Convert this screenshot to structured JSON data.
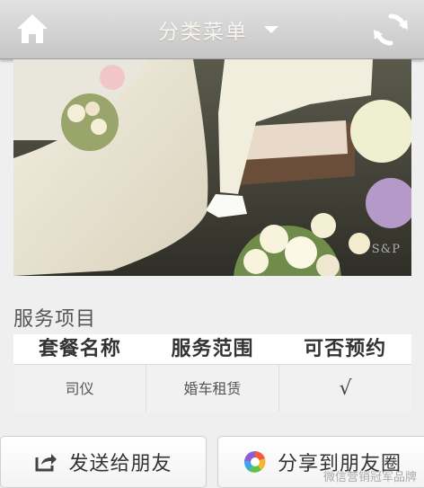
{
  "header": {
    "menu_title": "分类菜单",
    "home_icon": "home-icon",
    "refresh_icon": "refresh-icon"
  },
  "photo": {
    "watermark": "S&P"
  },
  "services": {
    "section_title": "服务项目",
    "columns": [
      "套餐名称",
      "服务范围",
      "可否预约"
    ],
    "rows": [
      {
        "name": "司仪",
        "scope": "婚车租赁",
        "bookable": "√"
      }
    ]
  },
  "actions": {
    "send_label": "发送给朋友",
    "share_label": "分享到朋友圈"
  },
  "footer": {
    "watermark_text": "微信营销冠军品牌"
  },
  "colors": {
    "header_gradient_top": "#e2e2e2",
    "header_gradient_bottom": "#c6c6c6",
    "title_text": "#faf5ef",
    "page_bg": "#efefef"
  }
}
